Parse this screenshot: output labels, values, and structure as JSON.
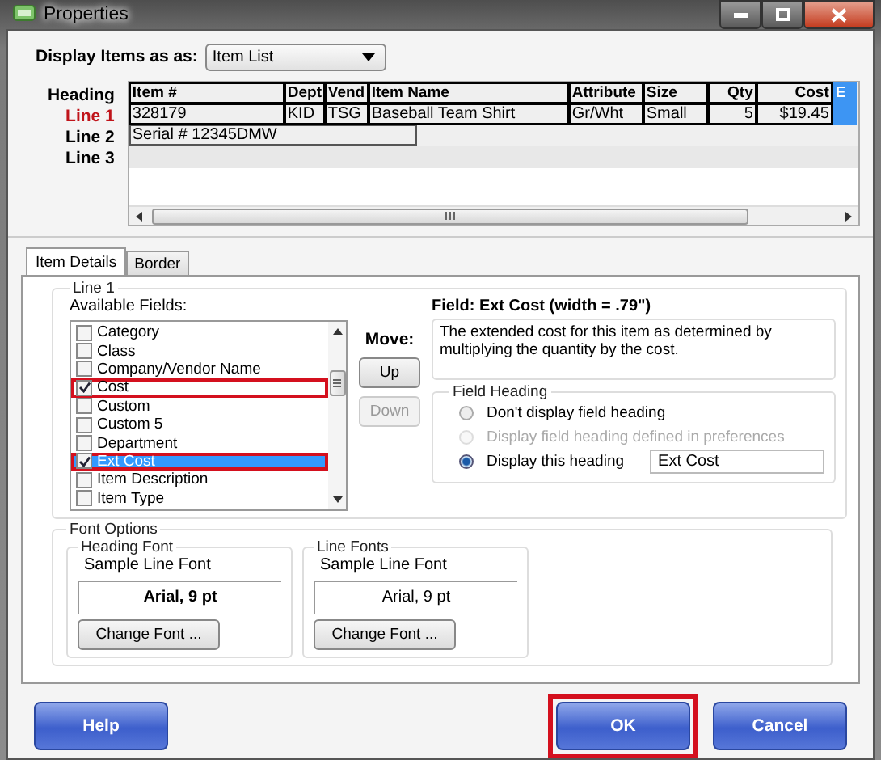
{
  "window": {
    "title": "Properties"
  },
  "display_items": {
    "label": "Display Items as as:",
    "value": "Item List"
  },
  "preview": {
    "line_labels": [
      {
        "text": "Heading",
        "selected": false
      },
      {
        "text": "Line 1",
        "selected": true
      },
      {
        "text": "Line 2",
        "selected": false
      },
      {
        "text": "Line 3",
        "selected": false
      }
    ],
    "columns": [
      {
        "label": "Item #",
        "selected": false
      },
      {
        "label": "Dept",
        "selected": false
      },
      {
        "label": "Vend",
        "selected": false
      },
      {
        "label": "Item Name",
        "selected": false
      },
      {
        "label": "Attribute",
        "selected": false
      },
      {
        "label": "Size",
        "selected": false
      },
      {
        "label": "Qty",
        "right_aligned": true,
        "selected": false
      },
      {
        "label": "Cost",
        "right_aligned": true,
        "selected": false
      },
      {
        "label": "E",
        "selected": true
      }
    ],
    "line_1": [
      "328179",
      "KID",
      "TSG",
      "Baseball Team Shirt",
      "Gr/Wht",
      "Small",
      "5",
      "$19.45"
    ],
    "line_2": [
      "Serial # 12345DMW"
    ]
  },
  "tabs": [
    {
      "label": "Item Details",
      "selected": true
    },
    {
      "label": "Border",
      "selected": false
    }
  ],
  "line_group": {
    "title": "Line 1",
    "fields_label": "Available Fields:",
    "fields": [
      {
        "label": "Category",
        "checked": false,
        "selected": false,
        "highlighted": false
      },
      {
        "label": "Class",
        "checked": false,
        "selected": false,
        "highlighted": false
      },
      {
        "label": "Company/Vendor Name",
        "checked": false,
        "selected": false,
        "highlighted": false
      },
      {
        "label": "Cost",
        "checked": true,
        "selected": false,
        "highlighted": true
      },
      {
        "label": "Custom",
        "checked": false,
        "selected": false,
        "highlighted": false
      },
      {
        "label": "Custom 5",
        "checked": false,
        "selected": false,
        "highlighted": false
      },
      {
        "label": "Department",
        "checked": false,
        "selected": false,
        "highlighted": false
      },
      {
        "label": "Ext Cost",
        "checked": true,
        "selected": true,
        "highlighted": true
      },
      {
        "label": "Item Description",
        "checked": false,
        "selected": false,
        "highlighted": false
      },
      {
        "label": "Item Type",
        "checked": false,
        "selected": false,
        "highlighted": false
      }
    ]
  },
  "move": {
    "label": "Move:",
    "buttons": [
      {
        "label": "Up",
        "disabled": false
      },
      {
        "label": "Down",
        "disabled": true
      }
    ]
  },
  "field_info": {
    "title": "Field: Ext Cost (width = .79\")",
    "description": "The extended cost for this item as determined by multiplying the quantity by the cost."
  },
  "field_heading": {
    "title": "Field Heading",
    "options": [
      {
        "label": "Don't display field heading",
        "selected": false,
        "disabled": false
      },
      {
        "label": "Display field heading defined in preferences",
        "selected": false,
        "disabled": true
      },
      {
        "label": "Display this heading",
        "selected": true,
        "disabled": false
      }
    ],
    "heading_value": "Ext Cost"
  },
  "font_options": {
    "title": "Font Options",
    "groups": [
      {
        "title": "Heading Font",
        "sample_label": "Sample Line Font",
        "sample": "Arial, 9 pt",
        "bold": true,
        "button": "Change Font ..."
      },
      {
        "title": "Line Fonts",
        "sample_label": "Sample Line Font",
        "sample": "Arial, 9 pt",
        "bold": false,
        "button": "Change Font ..."
      }
    ]
  },
  "buttons": [
    {
      "label": "Help",
      "highlighted": false
    },
    {
      "label": "OK",
      "highlighted": true
    },
    {
      "label": "Cancel",
      "highlighted": false
    }
  ]
}
